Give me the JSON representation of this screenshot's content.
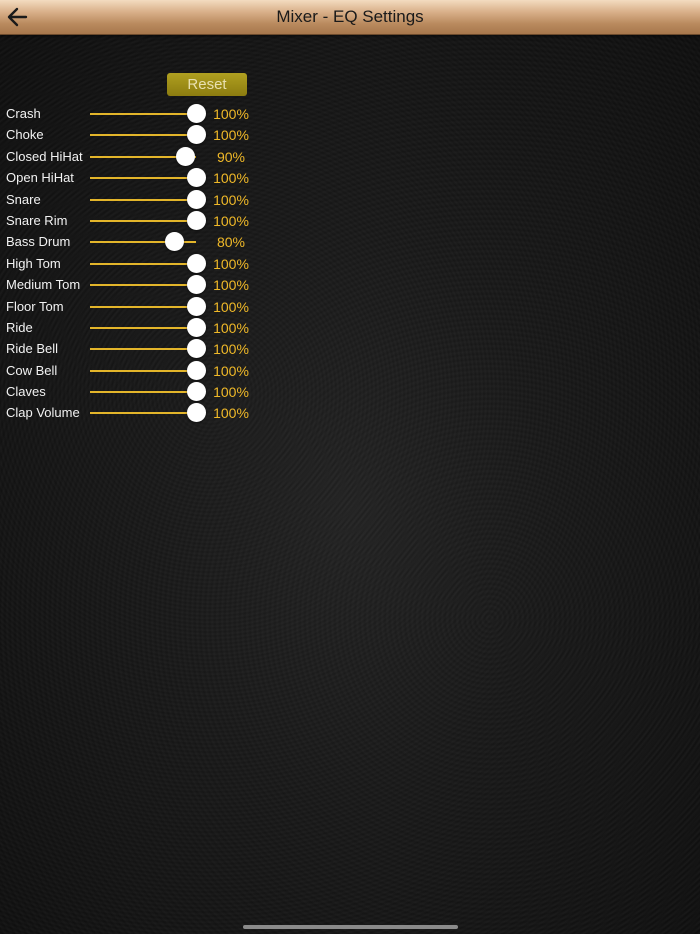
{
  "header": {
    "title": "Mixer - EQ Settings",
    "back_icon": "arrow-left-icon"
  },
  "reset_label": "Reset",
  "colors": {
    "accent": "#f0b928",
    "track": "#e3b52a",
    "reset_bg": "#9c8c18"
  },
  "channels": [
    {
      "label": "Crash",
      "value": "100%",
      "level": 1.0
    },
    {
      "label": "Choke",
      "value": "100%",
      "level": 1.0
    },
    {
      "label": "Closed HiHat",
      "value": "90%",
      "level": 0.9
    },
    {
      "label": "Open HiHat",
      "value": "100%",
      "level": 1.0
    },
    {
      "label": "Snare",
      "value": "100%",
      "level": 1.0
    },
    {
      "label": "Snare Rim",
      "value": "100%",
      "level": 1.0
    },
    {
      "label": "Bass Drum",
      "value": "80%",
      "level": 0.8
    },
    {
      "label": "High Tom",
      "value": "100%",
      "level": 1.0
    },
    {
      "label": "Medium Tom",
      "value": "100%",
      "level": 1.0
    },
    {
      "label": "Floor Tom",
      "value": "100%",
      "level": 1.0
    },
    {
      "label": "Ride",
      "value": "100%",
      "level": 1.0
    },
    {
      "label": "Ride Bell",
      "value": "100%",
      "level": 1.0
    },
    {
      "label": "Cow Bell",
      "value": "100%",
      "level": 1.0
    },
    {
      "label": "Claves",
      "value": "100%",
      "level": 1.0
    },
    {
      "label": "Clap Volume",
      "value": "100%",
      "level": 1.0
    }
  ]
}
